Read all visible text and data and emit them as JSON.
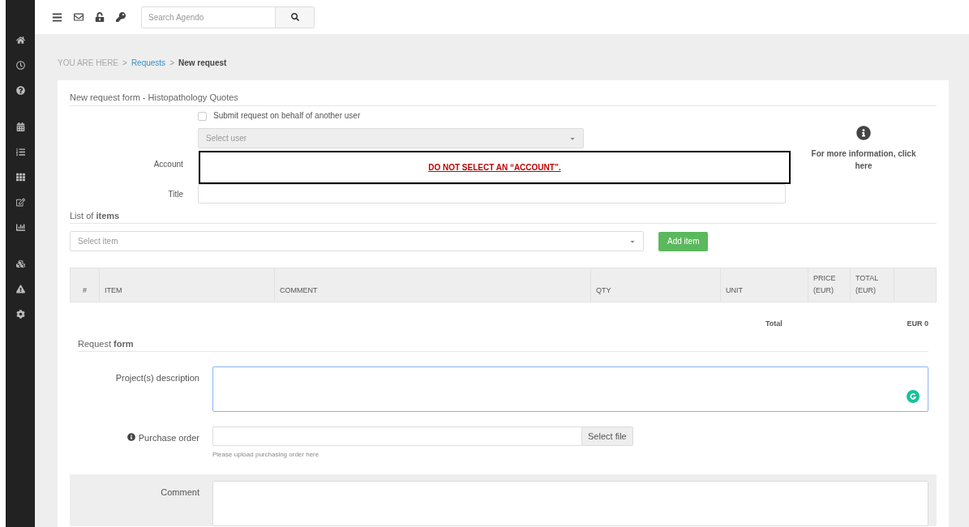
{
  "topbar": {
    "search": {
      "placeholder": "Search Agendo"
    }
  },
  "breadcrumb": {
    "separator": ">",
    "items": [
      {
        "label": "YOU ARE HERE",
        "kind": "text"
      },
      {
        "label": "Requests",
        "kind": "link"
      },
      {
        "label": "New request",
        "kind": "current"
      }
    ]
  },
  "form": {
    "title": "New request form - Histopathology Quotes",
    "on_behalf": {
      "label": "Submit request on behalf of another user",
      "checked": false
    },
    "user_select": {
      "placeholder": "Select user",
      "disabled": true
    },
    "account": {
      "label": "Account",
      "notice": "DO NOT SELECT AN “ACCOUNT”."
    },
    "title_field": {
      "label": "Title"
    },
    "info": {
      "text": "For more information, click here"
    }
  },
  "items": {
    "heading": "List of **items**",
    "select_placeholder": "Select item",
    "add_button": "Add item",
    "columns": [
      "#",
      "ITEM",
      "COMMENT",
      "QTY",
      "UNIT",
      "PRICE (EUR)",
      "TOTAL (EUR)"
    ],
    "total_label": "Total",
    "total_value": "EUR 0"
  },
  "request_form": {
    "heading": "Request **form**",
    "fields": [
      {
        "kind": "textarea",
        "label": "Project(s) description",
        "focused": true,
        "shaded": false
      },
      {
        "kind": "file",
        "label": "Purchase order",
        "info": true,
        "button": "Select file",
        "help": "Please upload purchasing order here",
        "shaded": false
      },
      {
        "kind": "textarea",
        "label": "Comment",
        "focused": false,
        "shaded": true
      }
    ]
  }
}
